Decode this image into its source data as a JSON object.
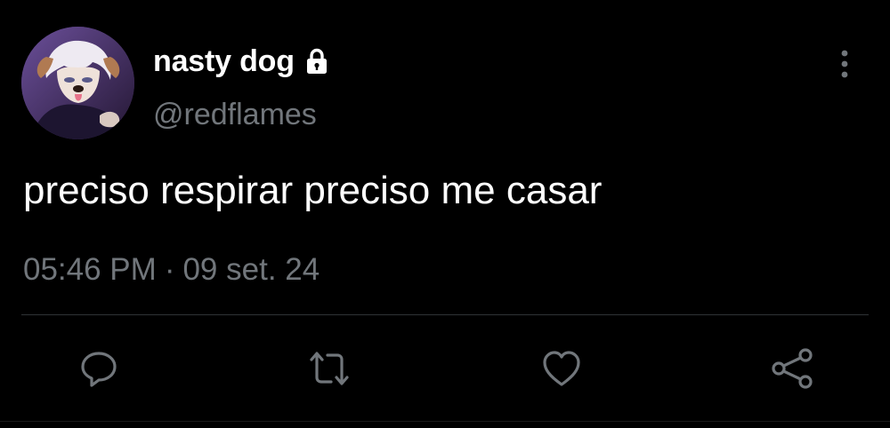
{
  "tweet": {
    "author": {
      "display_name": "nasty dog",
      "handle": "@redflames",
      "protected": true,
      "avatar_icon": "avatar-image"
    },
    "text": "preciso respirar preciso me casar",
    "time": "05:46 PM",
    "separator": "·",
    "date": "09 set. 24"
  },
  "actions": [
    {
      "name": "reply",
      "icon": "reply-icon"
    },
    {
      "name": "retweet",
      "icon": "retweet-icon"
    },
    {
      "name": "like",
      "icon": "heart-icon"
    },
    {
      "name": "share",
      "icon": "share-icon"
    }
  ],
  "colors": {
    "background": "#000000",
    "text_primary": "#ffffff",
    "text_secondary": "#71767b",
    "divider": "#2f3336"
  }
}
